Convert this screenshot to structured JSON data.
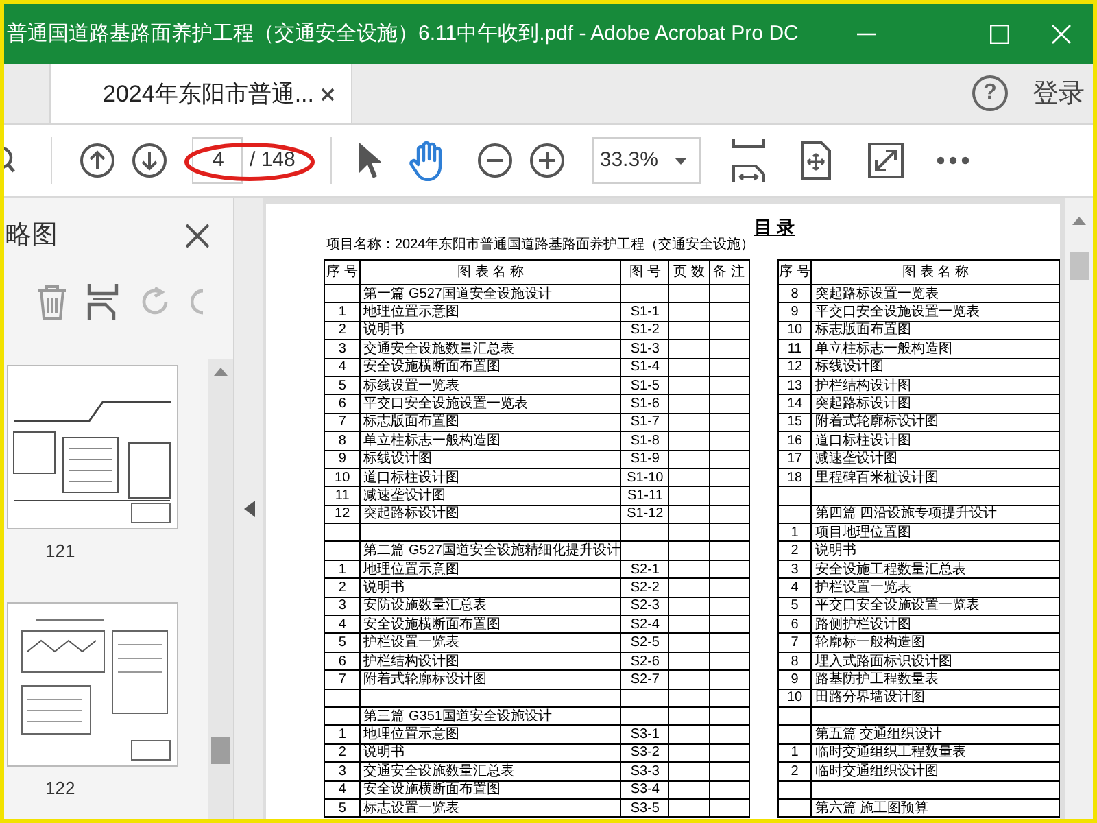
{
  "window": {
    "title": "普通国道路基路面养护工程（交通安全设施）6.11中午收到.pdf - Adobe Acrobat Pro DC"
  },
  "tabs": [
    {
      "label": "2024年东阳市普通...",
      "selected": true
    }
  ],
  "header": {
    "help": "?",
    "sign_in": "登录"
  },
  "toolbar": {
    "page_number": "4",
    "page_total": "/ 148",
    "zoom": "33.3%",
    "page_highlighted": true,
    "tools": [
      {
        "kind": "select",
        "selected": false
      },
      {
        "kind": "hand",
        "selected": true
      }
    ]
  },
  "sidebar": {
    "title": "略图",
    "thumbnails": [
      {
        "label": "121"
      },
      {
        "label": "122"
      }
    ]
  },
  "document": {
    "heading": "目 录",
    "project_line": "项目名称：2024年东阳市普通国道路基路面养护工程（交通安全设施）",
    "left_table": {
      "columns": [
        "序 号",
        "图 表 名 称",
        "图 号",
        "页 数",
        "备 注"
      ],
      "rows": [
        {
          "kind": "section",
          "name": "第一篇 G527国道安全设施设计"
        },
        {
          "kind": "item",
          "no": "1",
          "name": "地理位置示意图",
          "code": "S1-1"
        },
        {
          "kind": "item",
          "no": "2",
          "name": "说明书",
          "code": "S1-2"
        },
        {
          "kind": "item",
          "no": "3",
          "name": "交通安全设施数量汇总表",
          "code": "S1-3"
        },
        {
          "kind": "item",
          "no": "4",
          "name": "安全设施横断面布置图",
          "code": "S1-4"
        },
        {
          "kind": "item",
          "no": "5",
          "name": "标线设置一览表",
          "code": "S1-5"
        },
        {
          "kind": "item",
          "no": "6",
          "name": "平交口安全设施设置一览表",
          "code": "S1-6"
        },
        {
          "kind": "item",
          "no": "7",
          "name": "标志版面布置图",
          "code": "S1-7"
        },
        {
          "kind": "item",
          "no": "8",
          "name": "单立柱标志一般构造图",
          "code": "S1-8"
        },
        {
          "kind": "item",
          "no": "9",
          "name": "标线设计图",
          "code": "S1-9"
        },
        {
          "kind": "item",
          "no": "10",
          "name": "道口标柱设计图",
          "code": "S1-10"
        },
        {
          "kind": "item",
          "no": "11",
          "name": "减速垄设计图",
          "code": "S1-11"
        },
        {
          "kind": "item",
          "no": "12",
          "name": "突起路标设计图",
          "code": "S1-12"
        },
        {
          "kind": "blank"
        },
        {
          "kind": "section",
          "name": "第二篇 G527国道安全设施精细化提升设计"
        },
        {
          "kind": "item",
          "no": "1",
          "name": "地理位置示意图",
          "code": "S2-1"
        },
        {
          "kind": "item",
          "no": "2",
          "name": "说明书",
          "code": "S2-2"
        },
        {
          "kind": "item",
          "no": "3",
          "name": "安防设施数量汇总表",
          "code": "S2-3"
        },
        {
          "kind": "item",
          "no": "4",
          "name": "安全设施横断面布置图",
          "code": "S2-4"
        },
        {
          "kind": "item",
          "no": "5",
          "name": "护栏设置一览表",
          "code": "S2-5"
        },
        {
          "kind": "item",
          "no": "6",
          "name": "护栏结构设计图",
          "code": "S2-6"
        },
        {
          "kind": "item",
          "no": "7",
          "name": "附着式轮廓标设计图",
          "code": "S2-7"
        },
        {
          "kind": "blank"
        },
        {
          "kind": "section",
          "name": "第三篇 G351国道安全设施设计"
        },
        {
          "kind": "item",
          "no": "1",
          "name": "地理位置示意图",
          "code": "S3-1"
        },
        {
          "kind": "item",
          "no": "2",
          "name": "说明书",
          "code": "S3-2"
        },
        {
          "kind": "item",
          "no": "3",
          "name": "交通安全设施数量汇总表",
          "code": "S3-3"
        },
        {
          "kind": "item",
          "no": "4",
          "name": "安全设施横断面布置图",
          "code": "S3-4"
        },
        {
          "kind": "item",
          "no": "5",
          "name": "标志设置一览表",
          "code": "S3-5"
        }
      ]
    },
    "right_table": {
      "columns": [
        "序 号",
        "图 表 名 称"
      ],
      "rows": [
        {
          "kind": "item",
          "no": "8",
          "name": "突起路标设置一览表"
        },
        {
          "kind": "item",
          "no": "9",
          "name": "平交口安全设施设置一览表"
        },
        {
          "kind": "item",
          "no": "10",
          "name": "标志版面布置图"
        },
        {
          "kind": "item",
          "no": "11",
          "name": "单立柱标志一般构造图"
        },
        {
          "kind": "item",
          "no": "12",
          "name": "标线设计图"
        },
        {
          "kind": "item",
          "no": "13",
          "name": "护栏结构设计图"
        },
        {
          "kind": "item",
          "no": "14",
          "name": "突起路标设计图"
        },
        {
          "kind": "item",
          "no": "15",
          "name": "附着式轮廓标设计图"
        },
        {
          "kind": "item",
          "no": "16",
          "name": "道口标柱设计图"
        },
        {
          "kind": "item",
          "no": "17",
          "name": "减速垄设计图"
        },
        {
          "kind": "item",
          "no": "18",
          "name": "里程碑百米桩设计图"
        },
        {
          "kind": "blank"
        },
        {
          "kind": "section",
          "name": "第四篇 四沿设施专项提升设计"
        },
        {
          "kind": "item",
          "no": "1",
          "name": "项目地理位置图"
        },
        {
          "kind": "item",
          "no": "2",
          "name": "说明书"
        },
        {
          "kind": "item",
          "no": "3",
          "name": "安全设施工程数量汇总表"
        },
        {
          "kind": "item",
          "no": "4",
          "name": "护栏设置一览表"
        },
        {
          "kind": "item",
          "no": "5",
          "name": "平交口安全设施设置一览表"
        },
        {
          "kind": "item",
          "no": "6",
          "name": "路侧护栏设计图"
        },
        {
          "kind": "item",
          "no": "7",
          "name": "轮廓标一般构造图"
        },
        {
          "kind": "item",
          "no": "8",
          "name": "埋入式路面标识设计图"
        },
        {
          "kind": "item",
          "no": "9",
          "name": "路基防护工程数量表"
        },
        {
          "kind": "item",
          "no": "10",
          "name": "田路分界墙设计图"
        },
        {
          "kind": "blank"
        },
        {
          "kind": "section",
          "name": "第五篇 交通组织设计"
        },
        {
          "kind": "item",
          "no": "1",
          "name": "临时交通组织工程数量表"
        },
        {
          "kind": "item",
          "no": "2",
          "name": "临时交通组织设计图"
        },
        {
          "kind": "blank"
        },
        {
          "kind": "section",
          "name": "第六篇 施工图预算"
        }
      ]
    }
  }
}
